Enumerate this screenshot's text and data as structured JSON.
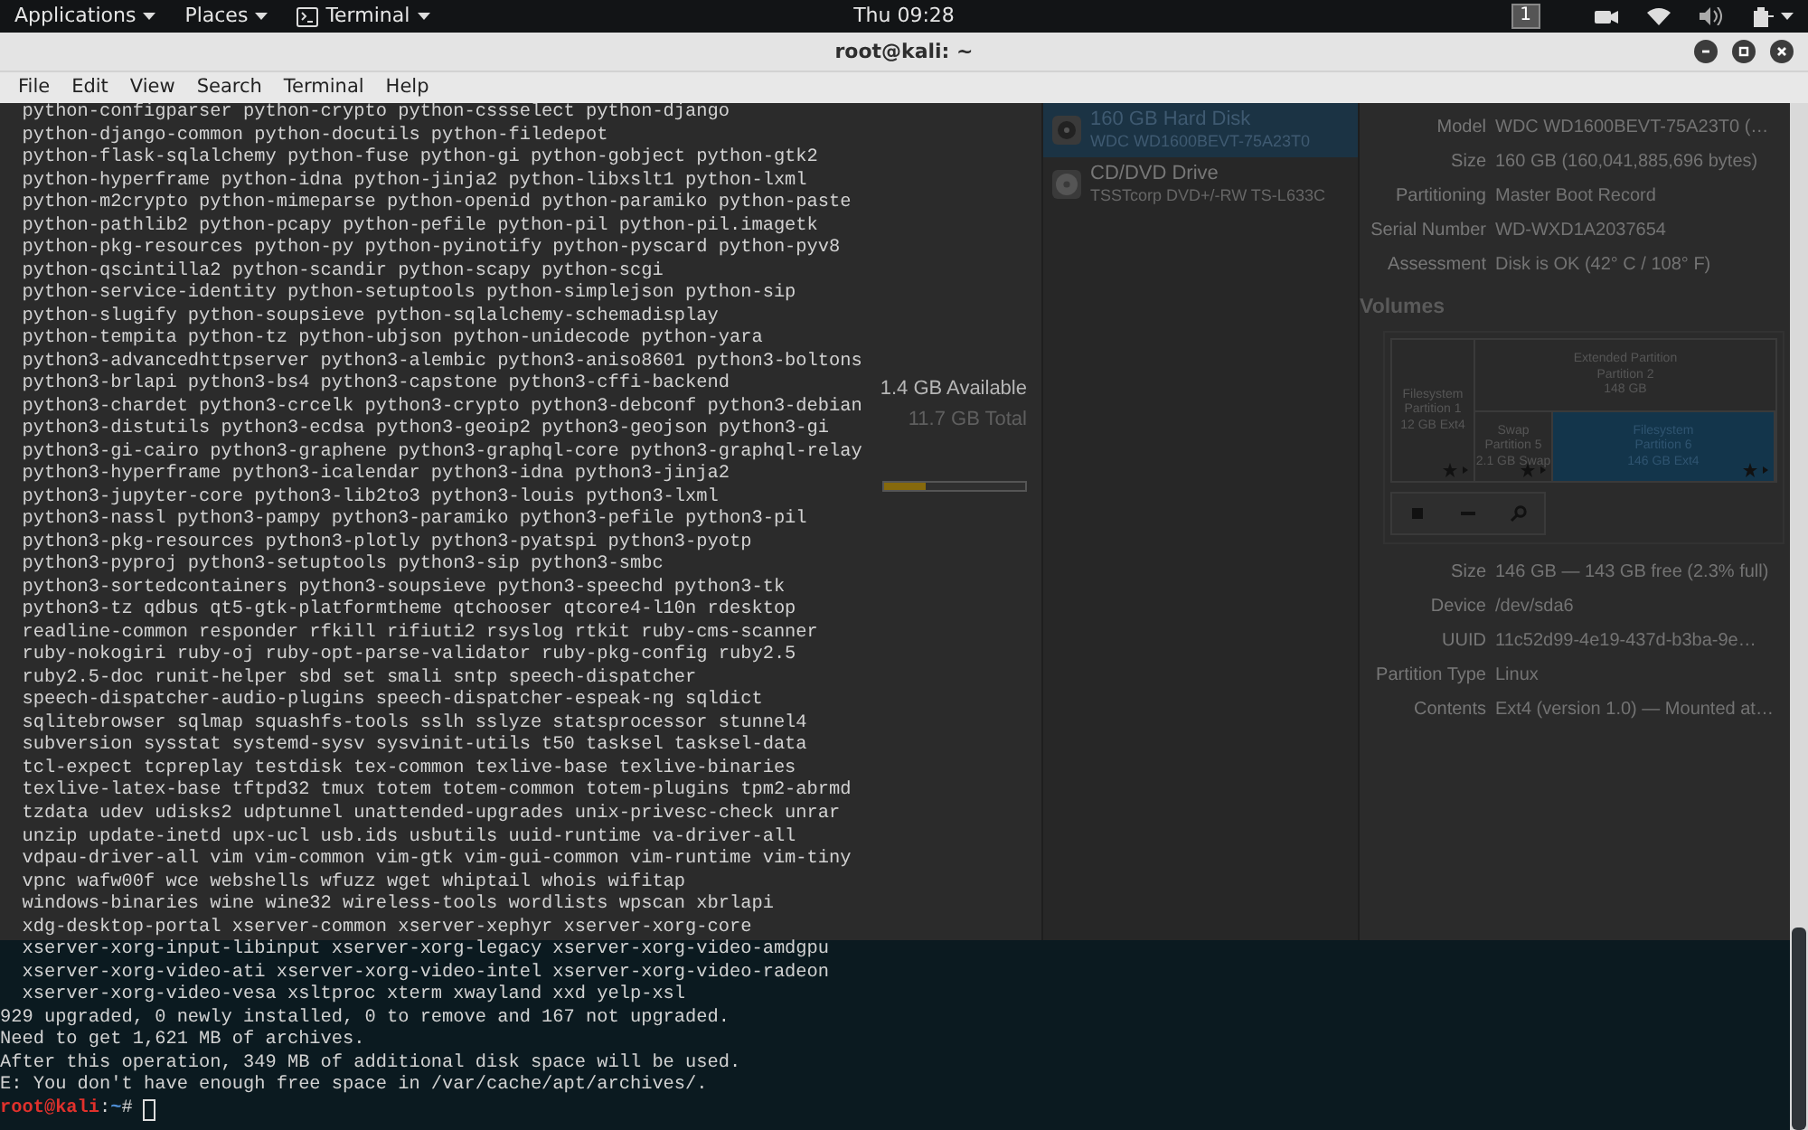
{
  "top_bar": {
    "menus": [
      {
        "label": "Applications",
        "kind": "menu"
      },
      {
        "label": "Places",
        "kind": "menu"
      },
      {
        "label": "Terminal",
        "kind": "app"
      }
    ],
    "clock": "Thu 09:28",
    "workspace": "1"
  },
  "window": {
    "title": "root@kali: ~"
  },
  "menu_bar": [
    "File",
    "Edit",
    "View",
    "Search",
    "Terminal",
    "Help"
  ],
  "terminal": {
    "lines": [
      "  python-configparser python-crypto python-cssselect python-django",
      "  python-django-common python-docutils python-filedepot",
      "  python-flask-sqlalchemy python-fuse python-gi python-gobject python-gtk2",
      "  python-hyperframe python-idna python-jinja2 python-libxslt1 python-lxml",
      "  python-m2crypto python-mimeparse python-openid python-paramiko python-paste",
      "  python-pathlib2 python-pcapy python-pefile python-pil python-pil.imagetk",
      "  python-pkg-resources python-py python-pyinotify python-pyscard python-pyv8",
      "  python-qscintilla2 python-scandir python-scapy python-scgi",
      "  python-service-identity python-setuptools python-simplejson python-sip",
      "  python-slugify python-soupsieve python-sqlalchemy-schemadisplay",
      "  python-tempita python-tz python-ubjson python-unidecode python-yara",
      "  python3-advancedhttpserver python3-alembic python3-aniso8601 python3-boltons",
      "  python3-brlapi python3-bs4 python3-capstone python3-cffi-backend",
      "  python3-chardet python3-crcelk python3-crypto python3-debconf python3-debian",
      "  python3-distutils python3-ecdsa python3-geoip2 python3-geojson python3-gi",
      "  python3-gi-cairo python3-graphene python3-graphql-core python3-graphql-relay",
      "  python3-hyperframe python3-icalendar python3-idna python3-jinja2",
      "  python3-jupyter-core python3-lib2to3 python3-louis python3-lxml",
      "  python3-nassl python3-pampy python3-paramiko python3-pefile python3-pil",
      "  python3-pkg-resources python3-plotly python3-pyatspi python3-pyotp",
      "  python3-pyproj python3-setuptools python3-sip python3-smbc",
      "  python3-sortedcontainers python3-soupsieve python3-speechd python3-tk",
      "  python3-tz qdbus qt5-gtk-platformtheme qtchooser qtcore4-l10n rdesktop",
      "  readline-common responder rfkill rifiuti2 rsyslog rtkit ruby-cms-scanner",
      "  ruby-nokogiri ruby-oj ruby-opt-parse-validator ruby-pkg-config ruby2.5",
      "  ruby2.5-doc runit-helper sbd set smali sntp speech-dispatcher",
      "  speech-dispatcher-audio-plugins speech-dispatcher-espeak-ng sqldict",
      "  sqlitebrowser sqlmap squashfs-tools sslh sslyze statsprocessor stunnel4",
      "  subversion sysstat systemd-sysv sysvinit-utils t50 tasksel tasksel-data",
      "  tcl-expect tcpreplay testdisk tex-common texlive-base texlive-binaries",
      "  texlive-latex-base tftpd32 tmux totem totem-common totem-plugins tpm2-abrmd",
      "  tzdata udev udisks2 udptunnel unattended-upgrades unix-privesc-check unrar",
      "  unzip update-inetd upx-ucl usb.ids usbutils uuid-runtime va-driver-all",
      "  vdpau-driver-all vim vim-common vim-gtk vim-gui-common vim-runtime vim-tiny",
      "  vpnc wafw00f wce webshells wfuzz wget whiptail whois wifitap",
      "  windows-binaries wine wine32 wireless-tools wordlists wpscan xbrlapi",
      "  xdg-desktop-portal xserver-common xserver-xephyr xserver-xorg-core",
      "  xserver-xorg-input-libinput xserver-xorg-legacy xserver-xorg-video-amdgpu",
      "  xserver-xorg-video-ati xserver-xorg-video-intel xserver-xorg-video-radeon",
      "  xserver-xorg-video-vesa xsltproc xterm xwayland xxd yelp-xsl",
      "929 upgraded, 0 newly installed, 0 to remove and 167 not upgraded.",
      "Need to get 1,621 MB of archives.",
      "After this operation, 349 MB of additional disk space will be used.",
      "E: You don't have enough free space in /var/cache/apt/archives/."
    ],
    "prompt": {
      "user": "root@kali",
      "separator": ":",
      "path": "~",
      "symbol": "#"
    }
  },
  "background_window": {
    "storage": {
      "available": "1.4 GB Available",
      "total": "11.7 GB Total",
      "level": 0.3
    },
    "drives": [
      {
        "name": "160 GB Hard Disk",
        "model": "WDC WD1600BEVT-75A23T0",
        "kind": "hdd",
        "selected": true
      },
      {
        "name": "CD/DVD Drive",
        "model": "TSSTcorp DVD+/-RW TS-L633C",
        "kind": "optical",
        "selected": false
      }
    ],
    "drive_details": [
      {
        "label": "Model",
        "value": "WDC WD1600BEVT-75A23T0 (…"
      },
      {
        "label": "Size",
        "value": "160 GB (160,041,885,696 bytes)"
      },
      {
        "label": "Partitioning",
        "value": "Master Boot Record"
      },
      {
        "label": "Serial Number",
        "value": "WD-WXD1A2037654"
      },
      {
        "label": "Assessment",
        "value": "Disk is OK (42° C / 108° F)"
      }
    ],
    "volumes_heading": "Volumes",
    "volumes": [
      {
        "kind": "partition",
        "lines": [
          "Filesystem",
          "Partition 1",
          "12 GB Ext4"
        ],
        "selected": false
      },
      {
        "kind": "extended",
        "lines": [
          "Extended Partition",
          "Partition 2",
          "148 GB"
        ],
        "selected": false,
        "children": [
          {
            "kind": "partition",
            "lines": [
              "Swap",
              "Partition 5",
              "2.1 GB Swap"
            ],
            "selected": false
          },
          {
            "kind": "partition",
            "lines": [
              "Filesystem",
              "Partition 6",
              "146 GB Ext4"
            ],
            "selected": true
          }
        ]
      }
    ],
    "volume_details": [
      {
        "label": "Size",
        "value": "146 GB — 143 GB free (2.3% full)"
      },
      {
        "label": "Device",
        "value": "/dev/sda6"
      },
      {
        "label": "UUID",
        "value": "11c52d99-4e19-437d-b3ba-9e…"
      },
      {
        "label": "Partition Type",
        "value": "Linux"
      },
      {
        "label": "Contents",
        "value": "Ext4 (version 1.0) — Mounted at…"
      }
    ]
  }
}
